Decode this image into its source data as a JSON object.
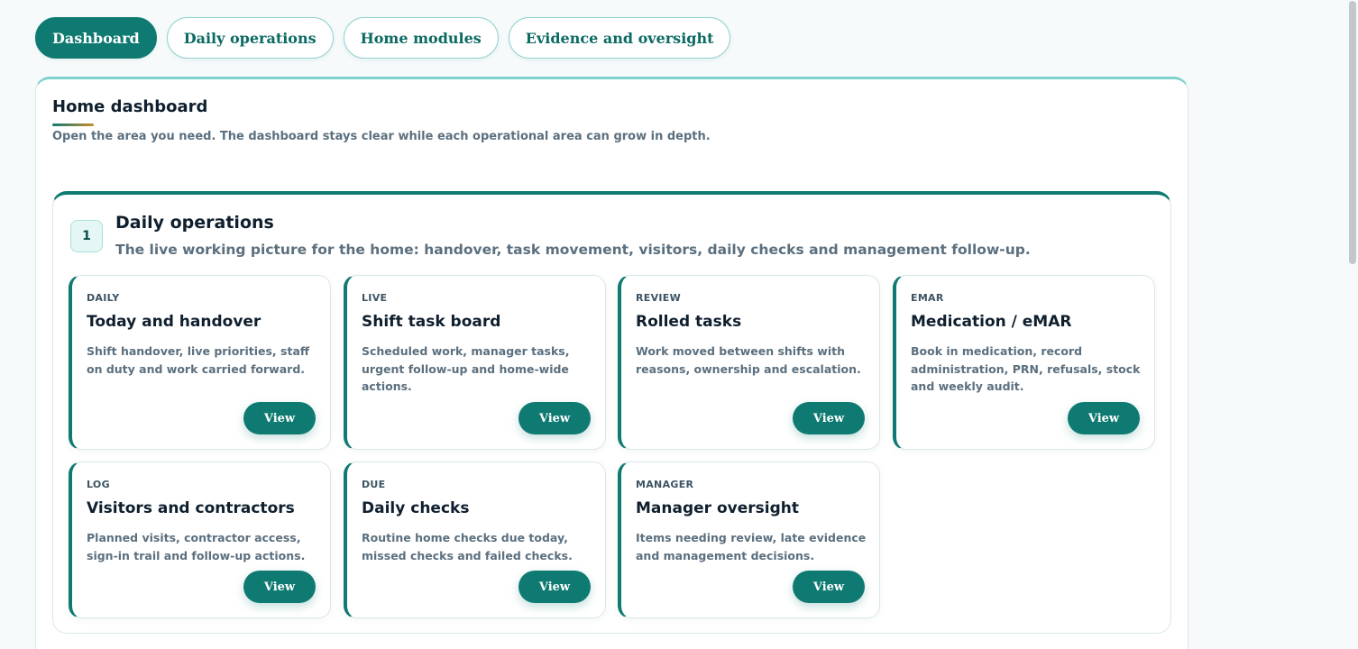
{
  "nav": {
    "tabs": [
      {
        "label": "Dashboard",
        "active": true
      },
      {
        "label": "Daily operations",
        "active": false
      },
      {
        "label": "Home modules",
        "active": false
      },
      {
        "label": "Evidence and oversight",
        "active": false
      }
    ]
  },
  "dashboard": {
    "title": "Home dashboard",
    "subtitle": "Open the area you need. The dashboard stays clear while each operational area can grow in depth."
  },
  "section": {
    "number": "1",
    "title": "Daily operations",
    "subtitle": "The live working picture for the home: handover, task movement, visitors, daily checks and management follow-up.",
    "cards": [
      {
        "tag": "DAILY",
        "title": "Today and handover",
        "description": "Shift handover, live priorities, staff on duty and work carried forward.",
        "button": "View"
      },
      {
        "tag": "LIVE",
        "title": "Shift task board",
        "description": "Scheduled work, manager tasks, urgent follow-up and home-wide actions.",
        "button": "View"
      },
      {
        "tag": "REVIEW",
        "title": "Rolled tasks",
        "description": "Work moved between shifts with reasons, ownership and escalation.",
        "button": "View"
      },
      {
        "tag": "EMAR",
        "title": "Medication / eMAR",
        "description": "Book in medication, record administration, PRN, refusals, stock and weekly audit.",
        "button": "View"
      },
      {
        "tag": "LOG",
        "title": "Visitors and contractors",
        "description": "Planned visits, contractor access, sign-in trail and follow-up actions.",
        "button": "View"
      },
      {
        "tag": "DUE",
        "title": "Daily checks",
        "description": "Routine home checks due today, missed checks and failed checks.",
        "button": "View"
      },
      {
        "tag": "MANAGER",
        "title": "Manager oversight",
        "description": "Items needing review, late evidence and management decisions.",
        "button": "View"
      }
    ]
  },
  "colors": {
    "accent": "#0f7a72",
    "accent_light": "#7fd1cc",
    "text_dark": "#0f1f2e",
    "text_muted": "#5b6f7e"
  }
}
